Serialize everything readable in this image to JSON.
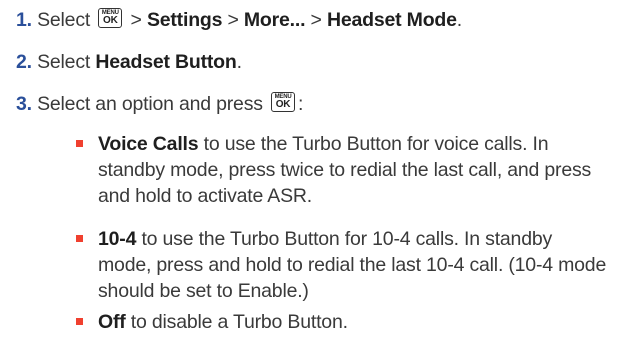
{
  "steps": [
    {
      "num": "1.",
      "text1": " Select ",
      "key": {
        "top": "MENU",
        "bottom": "OK"
      },
      "sep1": " > ",
      "b1": "Settings",
      "sep2": " > ",
      "b2": "More...",
      "sep3": " > ",
      "b3": "Headset Mode",
      "end": "."
    },
    {
      "num": "2.",
      "text1": " Select ",
      "b1": "Headset Button",
      "end": "."
    },
    {
      "num": "3.",
      "text1": " Select an option and press ",
      "key": {
        "top": "MENU",
        "bottom": "OK"
      },
      "end": ":"
    }
  ],
  "bullets": [
    {
      "bold": "Voice Calls",
      "text": " to use the Turbo Button for voice calls. In standby mode, press twice to redial the last call, and press and hold to activate ASR."
    },
    {
      "bold": "10-4",
      "text": " to use the Turbo Button for 10-4 calls. In standby mode, press and hold to redial the last 10-4 call. (10-4 mode should be set to Enable.)"
    },
    {
      "bold": "Off",
      "text": " to disable a Turbo Button."
    }
  ],
  "colors": {
    "step_number": "#2a4f9a",
    "bullet_marker": "#f0402f"
  },
  "icons": [
    "menu-ok-key-icon",
    "bullet-square-icon"
  ]
}
